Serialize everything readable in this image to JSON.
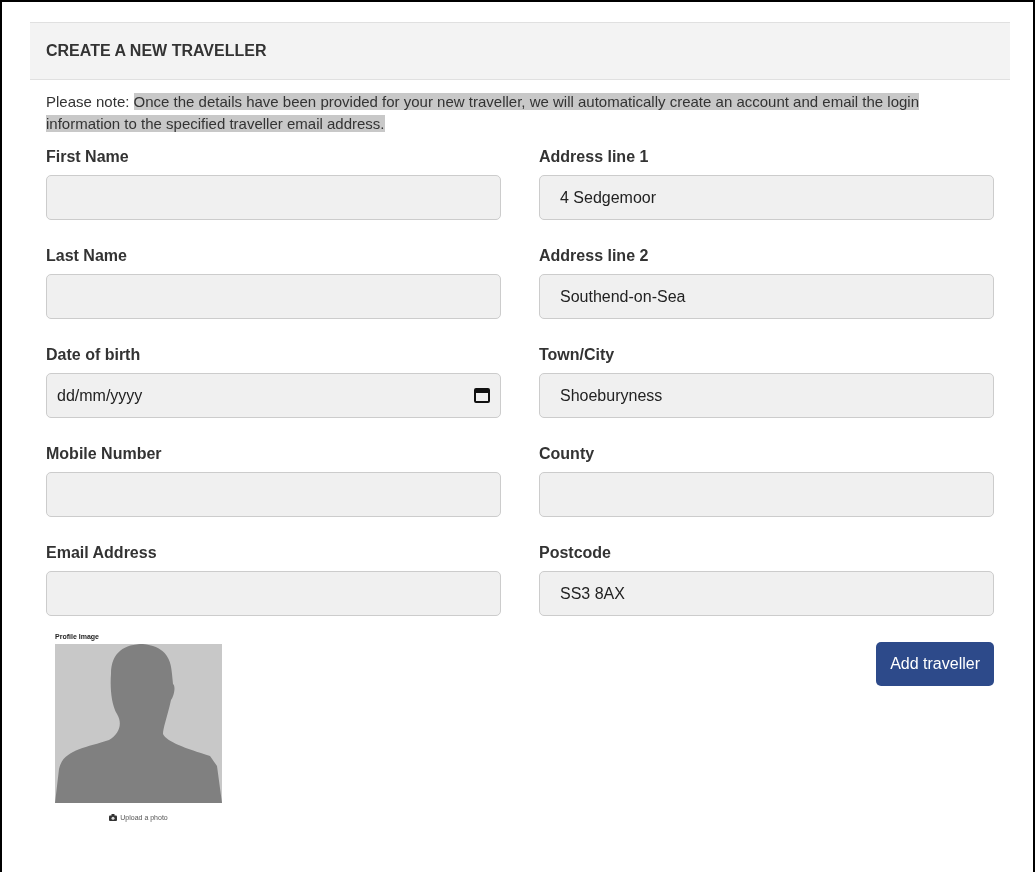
{
  "panel": {
    "title": "CREATE A NEW TRAVELLER"
  },
  "note": {
    "prefix": "Please note:",
    "highlighted": "Once the details have been provided for your new traveller, we will automatically create an account and email the login information to the specified traveller email address."
  },
  "left_fields": [
    {
      "label": "First Name",
      "kind": "text"
    },
    {
      "label": "Last Name",
      "kind": "text"
    },
    {
      "label": "Date of birth",
      "kind": "date",
      "placeholder": "dd/mm/yyyy"
    },
    {
      "label": "Mobile Number",
      "kind": "text"
    },
    {
      "label": "Email Address",
      "kind": "text"
    }
  ],
  "right_fields": [
    {
      "label": "Address line 1",
      "kind": "text",
      "value": "4 Sedgemoor"
    },
    {
      "label": "Address line 2",
      "kind": "text",
      "value": "Southend-on-Sea"
    },
    {
      "label": "Town/City",
      "kind": "text",
      "value": "Shoeburyness"
    },
    {
      "label": "County",
      "kind": "text"
    },
    {
      "label": "Postcode",
      "kind": "text",
      "value": "SS3 8AX"
    }
  ],
  "profile_image": {
    "label": "Profile Image",
    "upload_link": "Upload a photo"
  },
  "submit_button": "Add traveller"
}
